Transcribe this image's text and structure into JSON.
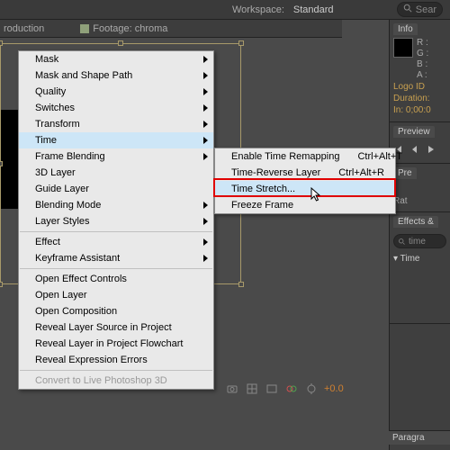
{
  "topbar": {
    "workspace_label": "Workspace:",
    "workspace_value": "Standard",
    "search_placeholder": "Sear"
  },
  "doc_tabs": {
    "left": "roduction",
    "right": "Footage: chroma"
  },
  "panels": {
    "info": {
      "title": "Info",
      "r": "R :",
      "g": "G :",
      "b": "B :",
      "a": "A :",
      "logo": "Logo ID",
      "duration": "Duration:",
      "inpoint": "In: 0;00:0"
    },
    "preview": {
      "title": "Preview",
      "controls": "▮◀  ◀  ▶"
    },
    "presets": {
      "title": "Pre",
      "rate": "Rat"
    },
    "effects": {
      "title": "Effects &",
      "search_value": "time",
      "sub": "Time"
    },
    "paragraph": {
      "title": "Paragra"
    }
  },
  "context_menu": [
    {
      "label": "Mask",
      "submenu": true
    },
    {
      "label": "Mask and Shape Path",
      "submenu": true
    },
    {
      "label": "Quality",
      "submenu": true
    },
    {
      "label": "Switches",
      "submenu": true
    },
    {
      "label": "Transform",
      "submenu": true
    },
    {
      "label": "Time",
      "submenu": true,
      "hover": true
    },
    {
      "label": "Frame Blending",
      "submenu": true
    },
    {
      "label": "3D Layer"
    },
    {
      "label": "Guide Layer"
    },
    {
      "label": "Blending Mode",
      "submenu": true
    },
    {
      "label": "Layer Styles",
      "submenu": true
    },
    {
      "sep": true
    },
    {
      "label": "Effect",
      "submenu": true
    },
    {
      "label": "Keyframe Assistant",
      "submenu": true
    },
    {
      "sep": true
    },
    {
      "label": "Open Effect Controls"
    },
    {
      "label": "Open Layer"
    },
    {
      "label": "Open Composition"
    },
    {
      "label": "Reveal Layer Source in Project"
    },
    {
      "label": "Reveal Layer in Project Flowchart"
    },
    {
      "label": "Reveal Expression Errors"
    },
    {
      "sep": true
    },
    {
      "label": "Convert to Live Photoshop 3D",
      "disabled": true
    }
  ],
  "submenu_time": [
    {
      "label": "Enable Time Remapping",
      "shortcut": "Ctrl+Alt+T"
    },
    {
      "label": "Time-Reverse Layer",
      "shortcut": "Ctrl+Alt+R"
    },
    {
      "label": "Time Stretch...",
      "hover": true
    },
    {
      "label": "Freeze Frame"
    }
  ],
  "viewer_controls": {
    "plus": "+0.0"
  }
}
